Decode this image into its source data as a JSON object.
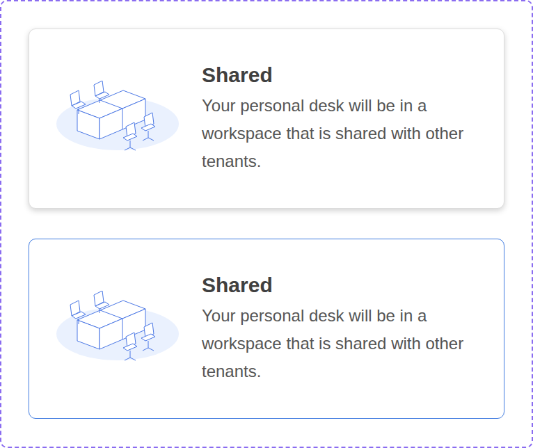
{
  "cards": [
    {
      "title": "Shared",
      "description": "Your personal desk will be in a workspace that is shared with other tenants.",
      "selected": false,
      "hovered": true
    },
    {
      "title": "Shared",
      "description": "Your personal desk will be in a workspace that is shared with other tenants.",
      "selected": true,
      "hovered": false
    }
  ]
}
